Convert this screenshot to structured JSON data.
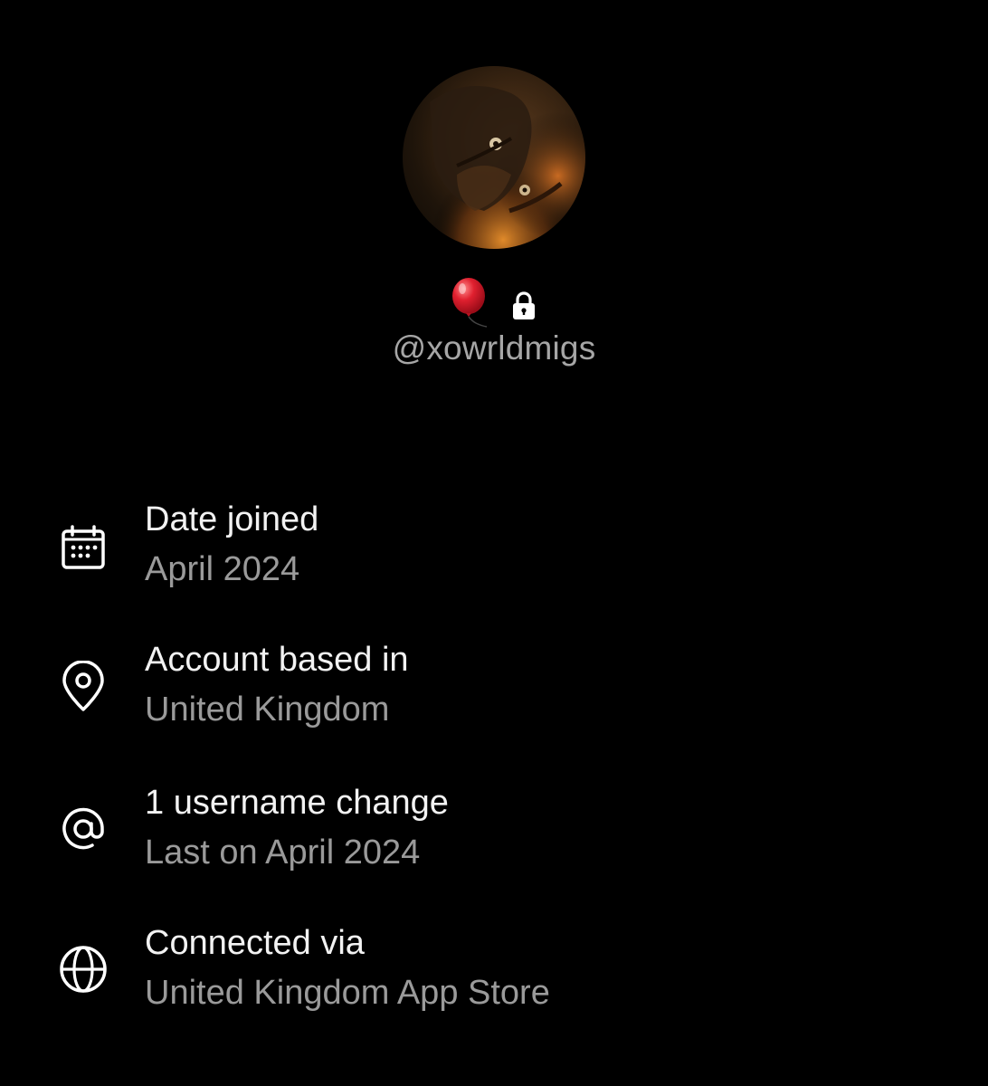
{
  "profile": {
    "avatar_icon": "profile-photo",
    "badge_icon": "red-balloon-emoji",
    "private_icon": "lock-icon",
    "handle": "@xowrldmigs"
  },
  "about": {
    "items": [
      {
        "icon": "calendar-icon",
        "label": "Date joined",
        "value": "April 2024"
      },
      {
        "icon": "location-pin-icon",
        "label": "Account based in",
        "value": "United Kingdom"
      },
      {
        "icon": "at-sign-icon",
        "label": "1 username change",
        "value": "Last on April 2024"
      },
      {
        "icon": "globe-icon",
        "label": "Connected via",
        "value": "United Kingdom App Store"
      }
    ]
  },
  "colors": {
    "background": "#000000",
    "primary_text": "#f2f2f2",
    "secondary_text": "#9a9a9a",
    "balloon": "#e0202f"
  }
}
